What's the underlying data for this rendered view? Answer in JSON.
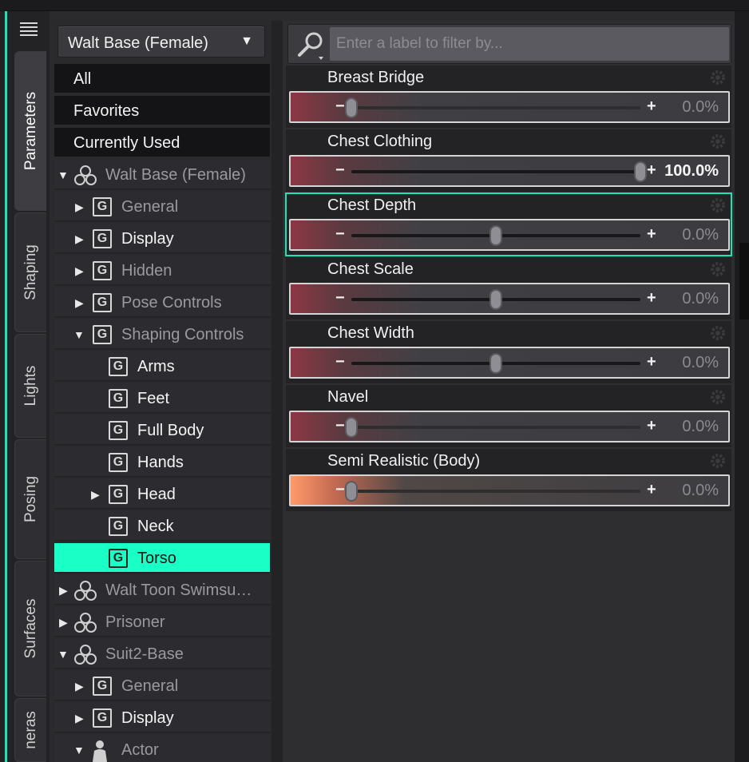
{
  "side_tabs": [
    "Parameters",
    "Shaping",
    "Lights",
    "Posing",
    "Surfaces",
    "neras"
  ],
  "preset": {
    "label": "Walt Base (Female)"
  },
  "search": {
    "placeholder": "Enter a label to filter by..."
  },
  "tree": [
    {
      "label": "All"
    },
    {
      "label": "Favorites"
    },
    {
      "label": "Currently Used"
    },
    {
      "label": "Walt Base (Female)"
    },
    {
      "label": "General"
    },
    {
      "label": "Display"
    },
    {
      "label": "Hidden"
    },
    {
      "label": "Pose Controls"
    },
    {
      "label": "Shaping Controls"
    },
    {
      "label": "Arms"
    },
    {
      "label": "Feet"
    },
    {
      "label": "Full Body"
    },
    {
      "label": "Hands"
    },
    {
      "label": "Head"
    },
    {
      "label": "Neck"
    },
    {
      "label": "Torso"
    },
    {
      "label": "Walt Toon Swimsu…"
    },
    {
      "label": "Prisoner"
    },
    {
      "label": "Suit2-Base"
    },
    {
      "label": "General"
    },
    {
      "label": "Display"
    },
    {
      "label": "Actor"
    }
  ],
  "sliders": [
    {
      "name": "Breast Bridge",
      "value": "0.0%",
      "fraction": 0.0
    },
    {
      "name": "Chest Clothing",
      "value": "100.0%",
      "fraction": 1.0
    },
    {
      "name": "Chest Depth",
      "value": "0.0%",
      "fraction": 0.5
    },
    {
      "name": "Chest Scale",
      "value": "0.0%",
      "fraction": 0.5
    },
    {
      "name": "Chest Width",
      "value": "0.0%",
      "fraction": 0.5
    },
    {
      "name": "Navel",
      "value": "0.0%",
      "fraction": 0.0
    },
    {
      "name": "Semi Realistic (Body)",
      "value": "0.0%",
      "fraction": 0.0
    }
  ],
  "colors": {
    "accent": "#1de3b8",
    "selected_row": "#1affc6"
  }
}
